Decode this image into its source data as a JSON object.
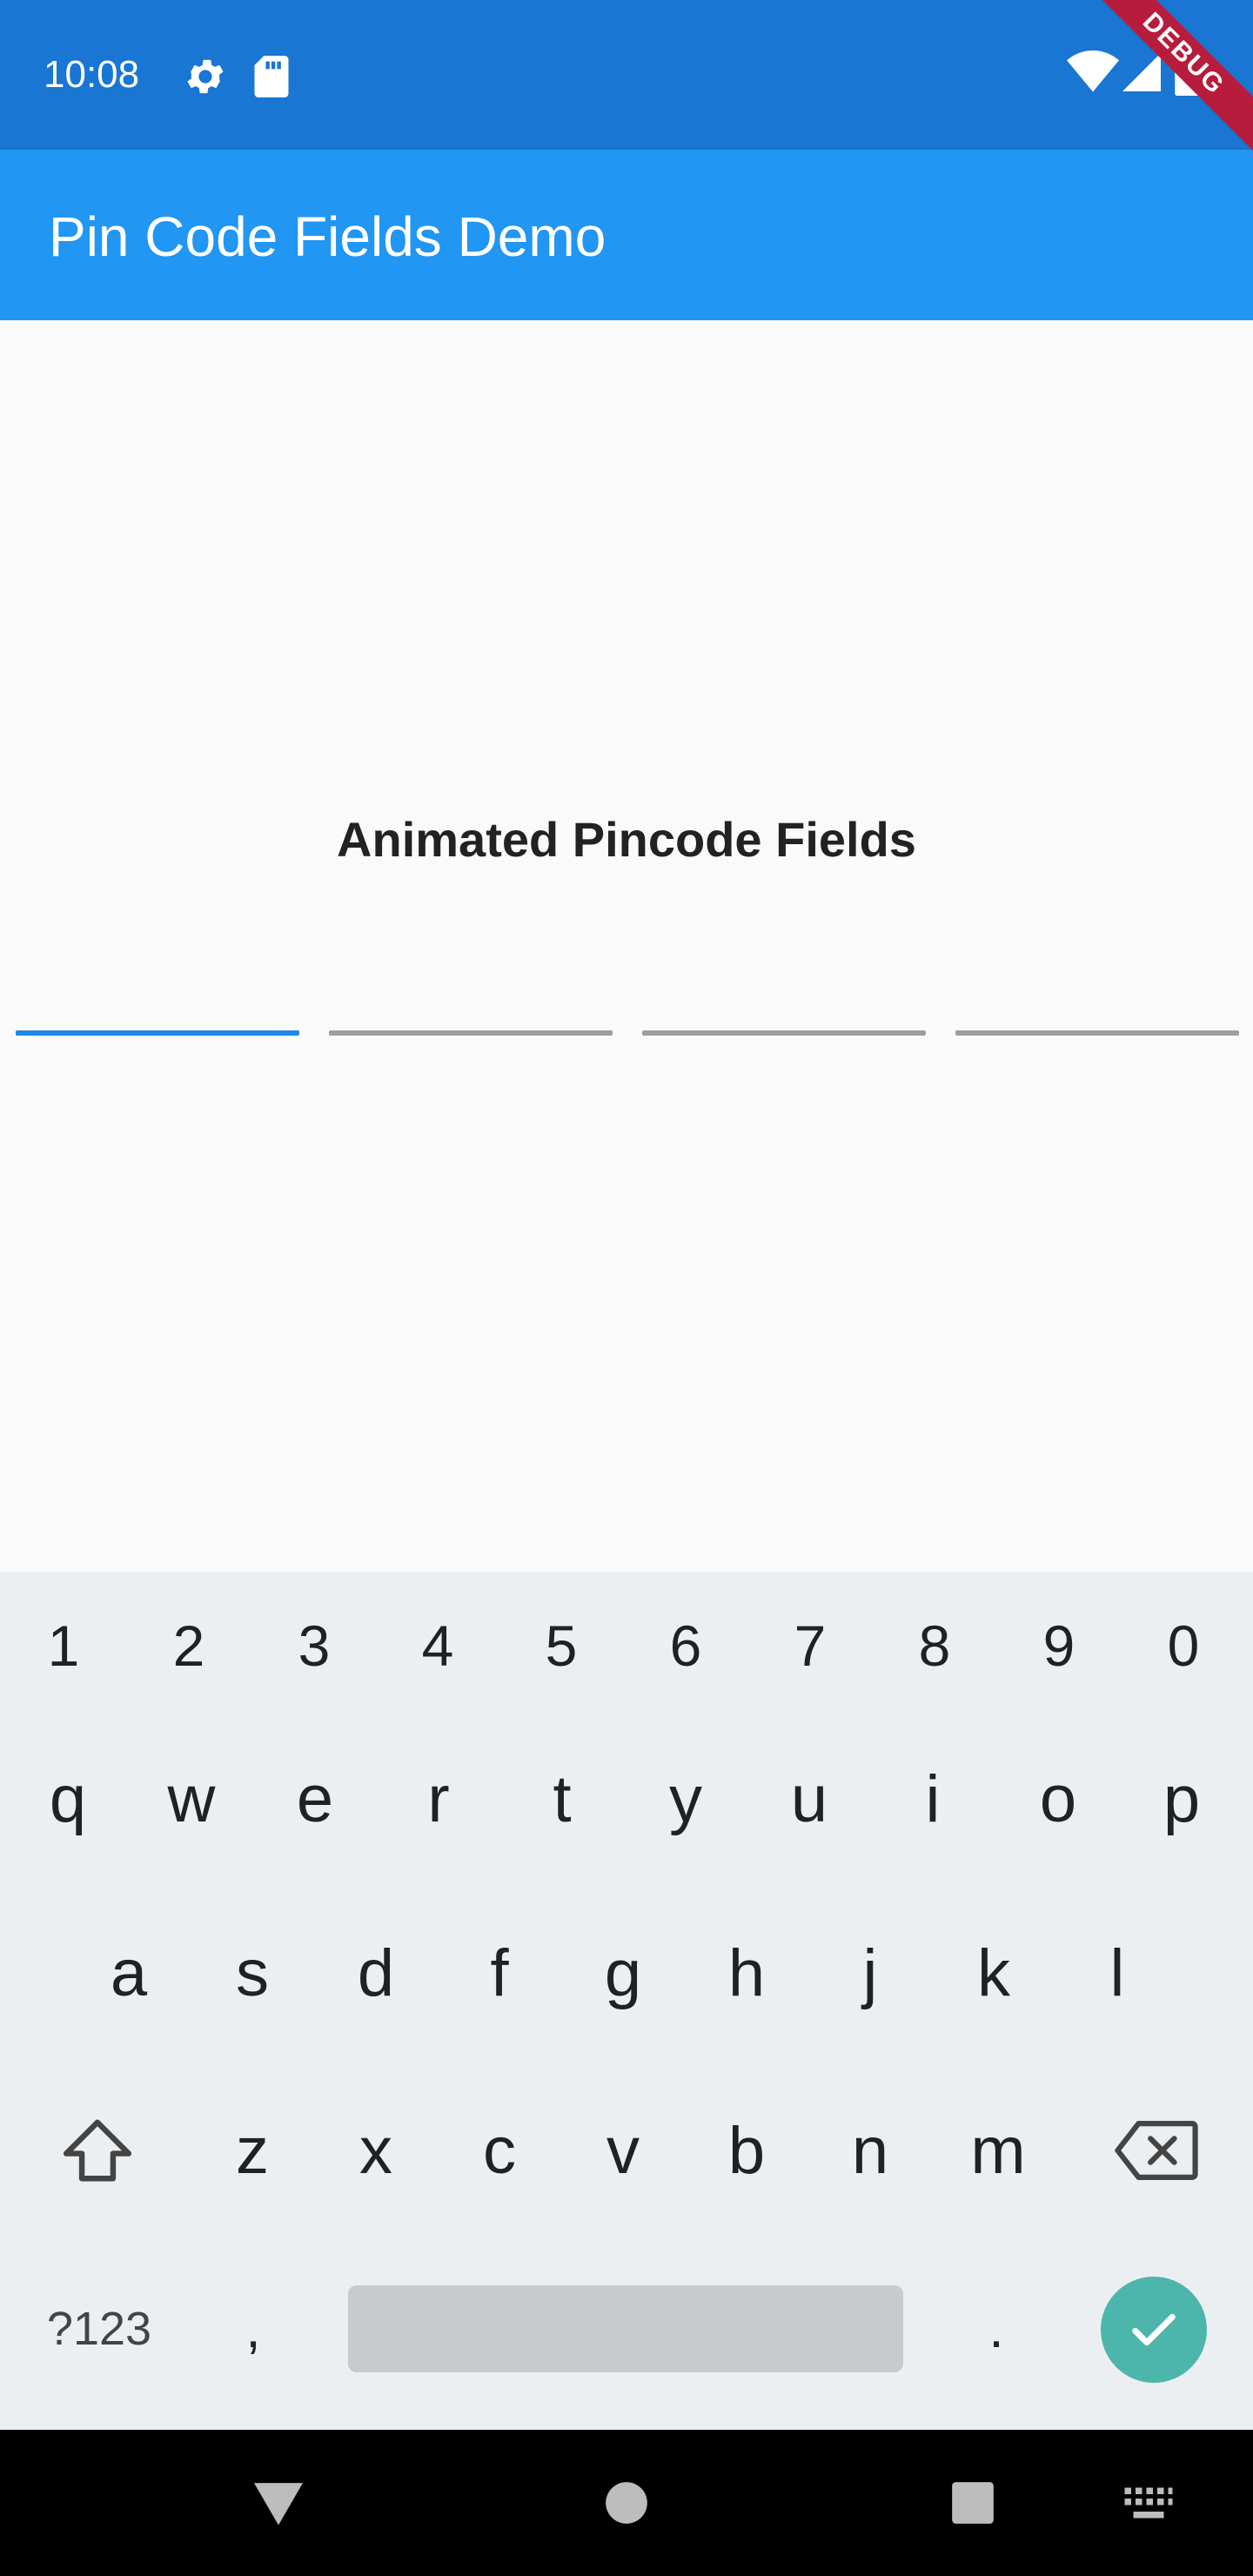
{
  "status_bar": {
    "time": "10:08",
    "icons": [
      "gear-icon",
      "sd-card-icon",
      "wifi-icon",
      "signal-icon",
      "battery-icon"
    ]
  },
  "app_bar": {
    "title": "Pin Code Fields Demo",
    "color": "#2196f3"
  },
  "debug_banner": "DEBUG",
  "main": {
    "heading": "Animated Pincode Fields",
    "pin_fields": {
      "count": 4,
      "active_index": 0,
      "active_color": "#1e88e5",
      "inactive_color": "#9e9e9e"
    }
  },
  "keyboard": {
    "numbers": [
      "1",
      "2",
      "3",
      "4",
      "5",
      "6",
      "7",
      "8",
      "9",
      "0"
    ],
    "row1": [
      "q",
      "w",
      "e",
      "r",
      "t",
      "y",
      "u",
      "i",
      "o",
      "p"
    ],
    "row2": [
      "a",
      "s",
      "d",
      "f",
      "g",
      "h",
      "j",
      "k",
      "l"
    ],
    "row3": [
      "z",
      "x",
      "c",
      "v",
      "b",
      "n",
      "m"
    ],
    "symbols_key": "?123",
    "comma": ",",
    "period": ".",
    "enter_color": "#4db6ac"
  },
  "nav_bar": {
    "icons": [
      "back-icon",
      "home-icon",
      "recents-icon",
      "keyboard-switch-icon"
    ]
  }
}
